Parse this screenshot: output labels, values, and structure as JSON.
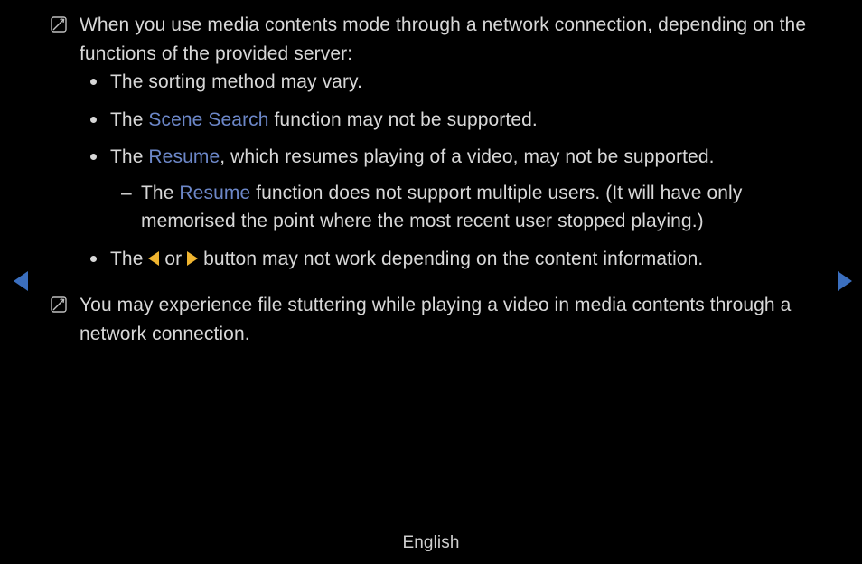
{
  "notes": [
    {
      "intro": "When you use media contents mode through a network connection, depending on the functions of the provided server:",
      "bullets": [
        {
          "parts": [
            {
              "t": "The sorting method may vary."
            }
          ]
        },
        {
          "parts": [
            {
              "t": "The "
            },
            {
              "t": "Scene Search",
              "hl": true
            },
            {
              "t": " function may not be supported."
            }
          ]
        },
        {
          "parts": [
            {
              "t": "The "
            },
            {
              "t": "Resume",
              "hl": true
            },
            {
              "t": ", which resumes playing of a video, may not be supported."
            }
          ],
          "sub": [
            {
              "parts": [
                {
                  "t": "The "
                },
                {
                  "t": "Resume",
                  "hl": true
                },
                {
                  "t": " function does not support multiple users. (It will have only memorised the point where the most recent user stopped playing.)"
                }
              ]
            }
          ]
        },
        {
          "parts": [
            {
              "t": "The "
            },
            {
              "icon": "tri-left"
            },
            {
              "t": " or "
            },
            {
              "icon": "tri-right"
            },
            {
              "t": " button may not work depending on the content information."
            }
          ]
        }
      ]
    },
    {
      "intro": "You may experience file stuttering while playing a video in media contents through a network connection."
    }
  ],
  "footer": {
    "language": "English"
  }
}
